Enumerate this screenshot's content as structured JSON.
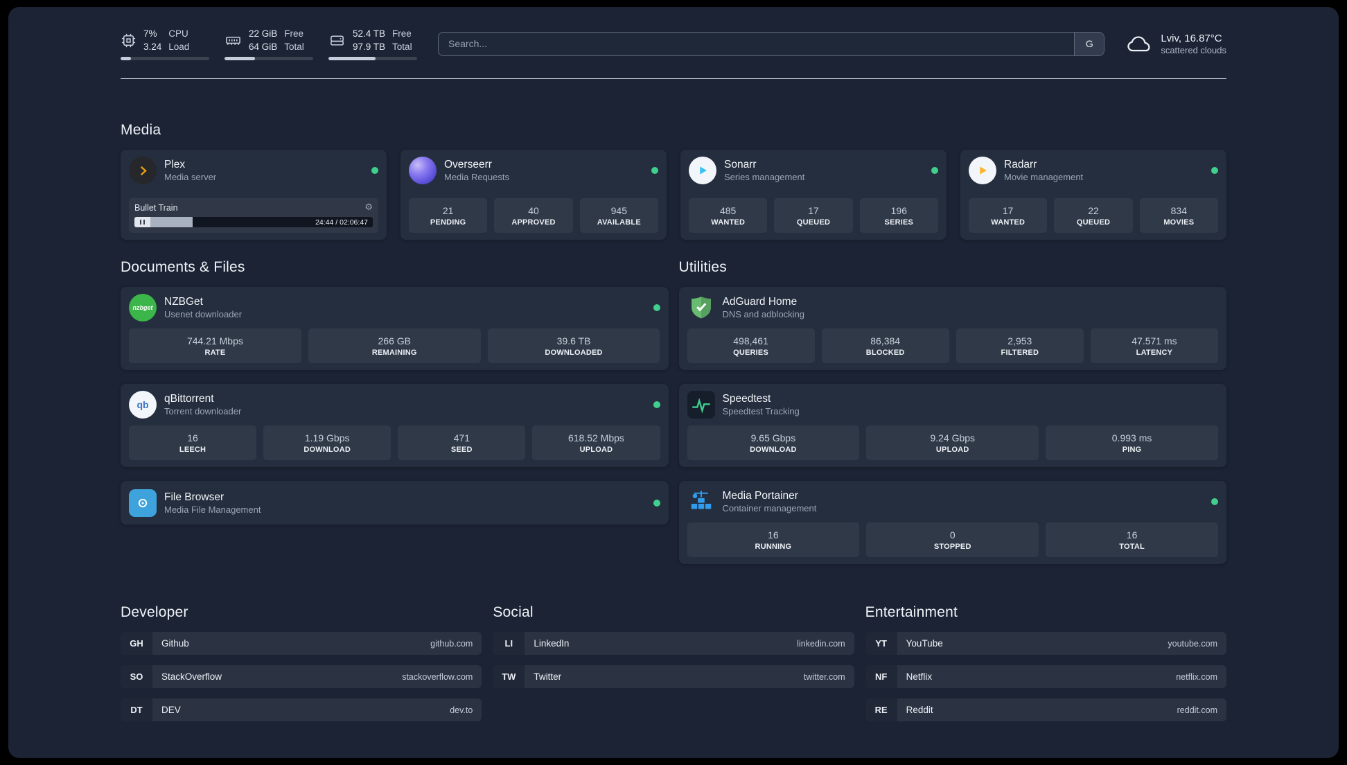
{
  "colors": {
    "status_online": "#41cf8e",
    "plex_amber": "#e5a00d",
    "page_bg": "#1b2334",
    "card_bg": "#252e3e"
  },
  "header": {
    "cpu": {
      "value1": "7%",
      "value2": "3.24",
      "label1": "CPU",
      "label2": "Load",
      "progress_pct": 12
    },
    "memory": {
      "value1": "22 GiB",
      "value2": "64 GiB",
      "label1": "Free",
      "label2": "Total",
      "progress_pct": 34
    },
    "disk": {
      "value1": "52.4 TB",
      "value2": "97.9 TB",
      "label1": "Free",
      "label2": "Total",
      "progress_pct": 53
    },
    "search": {
      "placeholder": "Search...",
      "provider_label": "G"
    },
    "weather": {
      "location": "Lviv, 16.87°C",
      "condition": "scattered clouds"
    }
  },
  "media": {
    "title": "Media",
    "cards": [
      {
        "name": "Plex",
        "desc": "Media server",
        "player": {
          "track": "Bullet Train",
          "time": "24:44 / 02:06:47",
          "progress_pct": 19
        }
      },
      {
        "name": "Overseerr",
        "desc": "Media Requests",
        "stats": [
          {
            "value": "21",
            "label": "PENDING"
          },
          {
            "value": "40",
            "label": "APPROVED"
          },
          {
            "value": "945",
            "label": "AVAILABLE"
          }
        ]
      },
      {
        "name": "Sonarr",
        "desc": "Series management",
        "stats": [
          {
            "value": "485",
            "label": "WANTED"
          },
          {
            "value": "17",
            "label": "QUEUED"
          },
          {
            "value": "196",
            "label": "SERIES"
          }
        ]
      },
      {
        "name": "Radarr",
        "desc": "Movie management",
        "stats": [
          {
            "value": "17",
            "label": "WANTED"
          },
          {
            "value": "22",
            "label": "QUEUED"
          },
          {
            "value": "834",
            "label": "MOVIES"
          }
        ]
      }
    ]
  },
  "documents": {
    "title": "Documents & Files",
    "cards": [
      {
        "name": "NZBGet",
        "desc": "Usenet downloader",
        "icon_text": "nzbget",
        "stats": [
          {
            "value": "744.21 Mbps",
            "label": "RATE"
          },
          {
            "value": "266 GB",
            "label": "REMAINING"
          },
          {
            "value": "39.6 TB",
            "label": "DOWNLOADED"
          }
        ]
      },
      {
        "name": "qBittorrent",
        "desc": "Torrent downloader",
        "icon_text": "qb",
        "stats": [
          {
            "value": "16",
            "label": "LEECH"
          },
          {
            "value": "1.19 Gbps",
            "label": "DOWNLOAD"
          },
          {
            "value": "471",
            "label": "SEED"
          },
          {
            "value": "618.52 Mbps",
            "label": "UPLOAD"
          }
        ]
      },
      {
        "name": "File Browser",
        "desc": "Media File Management"
      }
    ]
  },
  "utilities": {
    "title": "Utilities",
    "cards": [
      {
        "name": "AdGuard Home",
        "desc": "DNS and adblocking",
        "stats": [
          {
            "value": "498,461",
            "label": "QUERIES"
          },
          {
            "value": "86,384",
            "label": "BLOCKED"
          },
          {
            "value": "2,953",
            "label": "FILTERED"
          },
          {
            "value": "47.571 ms",
            "label": "LATENCY"
          }
        ]
      },
      {
        "name": "Speedtest",
        "desc": "Speedtest Tracking",
        "stats": [
          {
            "value": "9.65 Gbps",
            "label": "DOWNLOAD"
          },
          {
            "value": "9.24 Gbps",
            "label": "UPLOAD"
          },
          {
            "value": "0.993 ms",
            "label": "PING"
          }
        ]
      },
      {
        "name": "Media Portainer",
        "desc": "Container management",
        "stats": [
          {
            "value": "16",
            "label": "RUNNING"
          },
          {
            "value": "0",
            "label": "STOPPED"
          },
          {
            "value": "16",
            "label": "TOTAL"
          }
        ]
      }
    ]
  },
  "bookmarks": {
    "developer": {
      "title": "Developer",
      "items": [
        {
          "abbr": "GH",
          "name": "Github",
          "url": "github.com"
        },
        {
          "abbr": "SO",
          "name": "StackOverflow",
          "url": "stackoverflow.com"
        },
        {
          "abbr": "DT",
          "name": "DEV",
          "url": "dev.to"
        }
      ]
    },
    "social": {
      "title": "Social",
      "items": [
        {
          "abbr": "LI",
          "name": "LinkedIn",
          "url": "linkedin.com"
        },
        {
          "abbr": "TW",
          "name": "Twitter",
          "url": "twitter.com"
        }
      ]
    },
    "entertainment": {
      "title": "Entertainment",
      "items": [
        {
          "abbr": "YT",
          "name": "YouTube",
          "url": "youtube.com"
        },
        {
          "abbr": "NF",
          "name": "Netflix",
          "url": "netflix.com"
        },
        {
          "abbr": "RE",
          "name": "Reddit",
          "url": "reddit.com"
        }
      ]
    }
  }
}
